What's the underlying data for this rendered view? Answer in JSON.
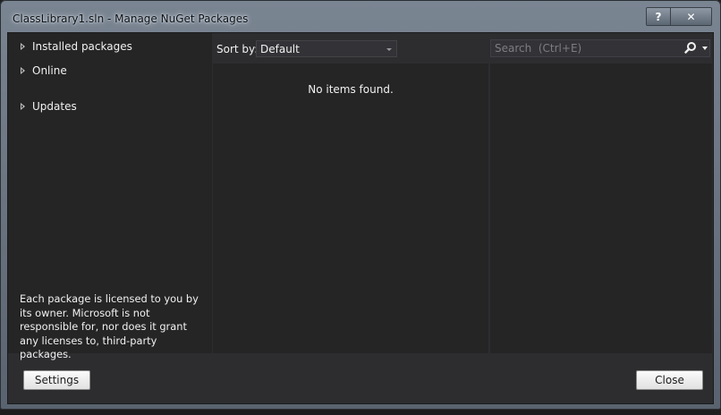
{
  "window": {
    "title": "ClassLibrary1.sln - Manage NuGet Packages",
    "help_label": "?",
    "close_label": "✕"
  },
  "sidebar": {
    "items": [
      {
        "label": "Installed packages"
      },
      {
        "label": "Online"
      },
      {
        "label": "Updates"
      }
    ],
    "license_text": "Each package is licensed to you by its owner. Microsoft is not responsible for, nor does it grant any licenses to, third-party packages."
  },
  "toolbar": {
    "sort_label": "Sort by:",
    "sort_value": "Default"
  },
  "search": {
    "placeholder": "Search  (Ctrl+E)",
    "value": ""
  },
  "results": {
    "empty_message": "No items found."
  },
  "buttons": {
    "settings_label": "Settings",
    "close_label": "Close"
  },
  "icons": {
    "search": "magnifier-icon",
    "expand": "triangle-right-icon",
    "dropdown": "chevron-down-icon"
  }
}
